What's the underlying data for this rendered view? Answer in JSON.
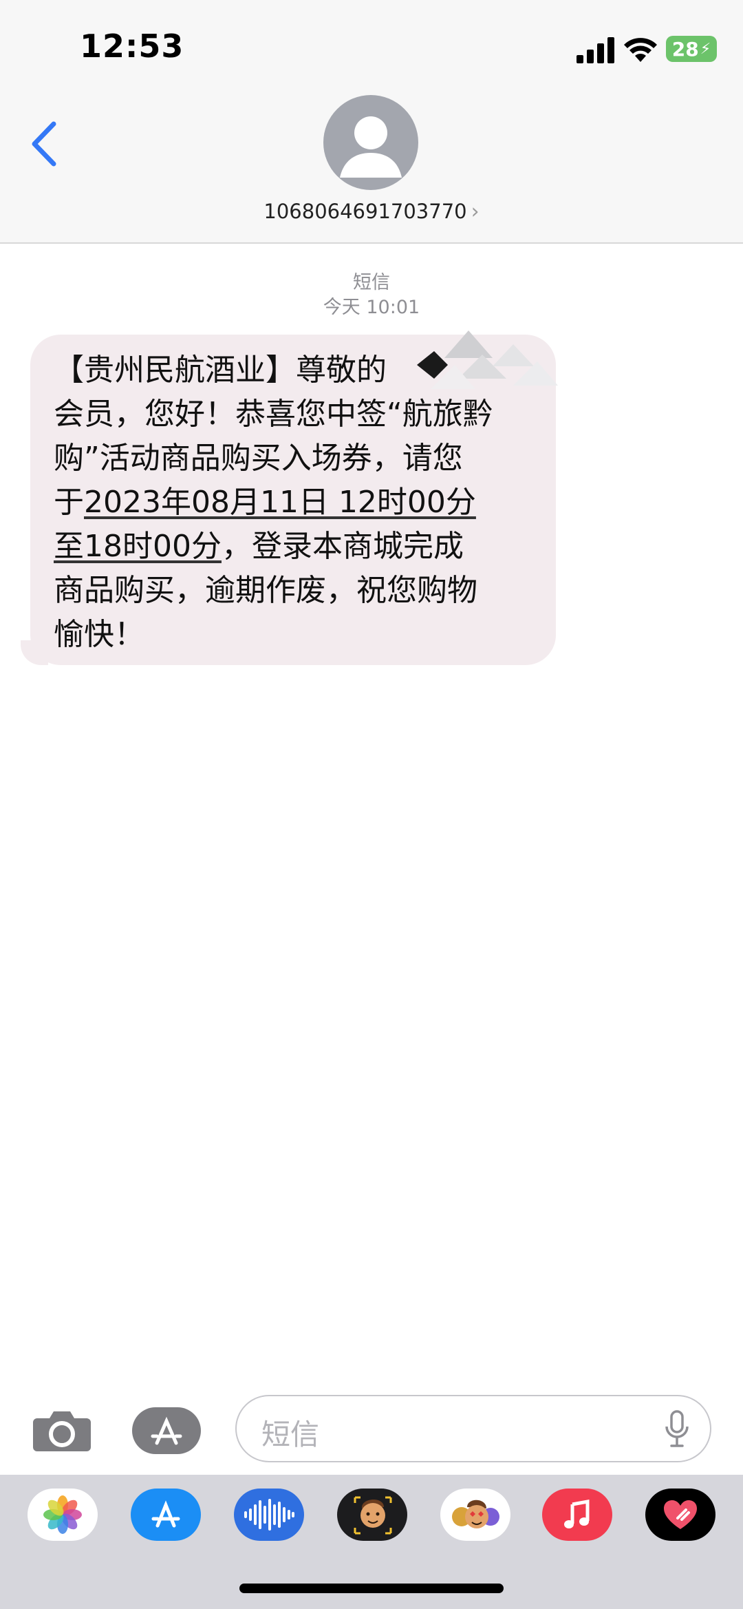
{
  "status_bar": {
    "time": "12:53",
    "battery_level": "28"
  },
  "header": {
    "contact_number": "1068064691703770",
    "chevron": "›"
  },
  "thread": {
    "service": "短信",
    "timestamp": "今天 10:01",
    "message": {
      "line1": "【贵州民航酒业】尊敬的",
      "line2": "会员，您好！恭喜您中签“航旅黔",
      "line3": "购”活动商品购买入场券，请您",
      "line4_prefix": "于",
      "line4_link": "2023年08月11日 12时00分",
      "line5_link": "至18时00分",
      "line5_rest": "，登录本商城完成",
      "line6": "商品购买，逾期作废，祝您购物",
      "line7": "愉快！"
    }
  },
  "composer": {
    "placeholder": "短信"
  },
  "app_drawer": {
    "apps": [
      "photos-icon",
      "app-store-icon",
      "audio-message-icon",
      "memoji-icon",
      "animoji-stickers-icon",
      "music-icon",
      "digital-touch-icon"
    ]
  },
  "colors": {
    "accent": "#3478f6",
    "bubble": "#f3ebee",
    "battery": "#6cc36a"
  }
}
